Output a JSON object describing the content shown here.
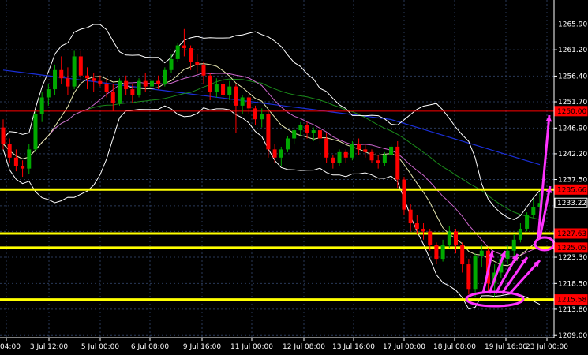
{
  "chart_data": {
    "type": "candlestick",
    "title": "",
    "xlabel": "",
    "ylabel": "",
    "ylim": [
      1209.0,
      1270.0
    ],
    "grid": true,
    "x_ticks": [
      "04:00",
      "3 Jul 12:00",
      "5 Jul 00:00",
      "6 Jul 08:00",
      "9 Jul 16:00",
      "11 Jul 00:00",
      "12 Jul 08:00",
      "13 Jul 16:00",
      "17 Jul 00:00",
      "18 Jul 08:00",
      "19 Jul 16:00",
      "23 Jul 00:00"
    ],
    "y_ticks": [
      1265.9,
      1261.2,
      1256.4,
      1251.7,
      1246.9,
      1242.2,
      1237.5,
      1232.7,
      1228.0,
      1223.3,
      1218.5,
      1213.8,
      1209.0
    ],
    "y_tick_labels": [
      "1265.90",
      "1261.20",
      "1256.40",
      "1251.70",
      "1246.90",
      "1242.20",
      "1237.50",
      "",
      "",
      "1223.30",
      "1218.50",
      "1213.80",
      "1209.00"
    ],
    "price_badges": [
      {
        "label": "1250.00",
        "value": 1250.0,
        "color": "#ff0000"
      },
      {
        "label": "1235.66",
        "value": 1235.66,
        "color": "#ff0000"
      },
      {
        "label": "1233.22",
        "value": 1233.22,
        "color": "#ffffff"
      },
      {
        "label": "1227.63",
        "value": 1227.63,
        "color": "#ff0000"
      },
      {
        "label": "1225.05",
        "value": 1225.05,
        "color": "#ff0000"
      },
      {
        "label": "1215.58",
        "value": 1215.58,
        "color": "#ff0000"
      }
    ],
    "horizontal_lines": [
      {
        "value": 1250.0,
        "color": "#ff0000"
      },
      {
        "value": 1235.66,
        "color": "#ffff00"
      },
      {
        "value": 1227.63,
        "color": "#ffff00"
      },
      {
        "value": 1225.05,
        "color": "#ffff00"
      },
      {
        "value": 1215.58,
        "color": "#ffff00"
      }
    ],
    "colors": {
      "up": "#00aa00",
      "down": "#ff0000",
      "grid": "#2a3a5a",
      "annotation": "#ff33ff",
      "blue_ma": "#1a2fd8",
      "green_ma": "#1a8a1a",
      "bands": "#ffffff",
      "mid_band": "#e8e8b0"
    },
    "candles": [
      [
        1247.0,
        1248.5,
        1243.0,
        1244.0
      ],
      [
        1244.0,
        1245.0,
        1240.5,
        1241.5
      ],
      [
        1241.5,
        1243.0,
        1239.0,
        1240.0
      ],
      [
        1240.0,
        1241.0,
        1238.0,
        1239.5
      ],
      [
        1239.5,
        1244.0,
        1238.5,
        1243.0
      ],
      [
        1243.0,
        1250.0,
        1242.5,
        1249.5
      ],
      [
        1249.5,
        1253.5,
        1248.0,
        1252.5
      ],
      [
        1252.5,
        1255.0,
        1251.0,
        1254.0
      ],
      [
        1254.0,
        1258.5,
        1253.0,
        1257.5
      ],
      [
        1257.5,
        1260.0,
        1255.0,
        1256.0
      ],
      [
        1256.0,
        1258.0,
        1253.0,
        1254.5
      ],
      [
        1254.5,
        1261.0,
        1254.0,
        1260.0
      ],
      [
        1260.0,
        1261.0,
        1255.5,
        1256.5
      ],
      [
        1256.5,
        1258.0,
        1254.0,
        1256.0
      ],
      [
        1256.0,
        1257.0,
        1253.5,
        1255.5
      ],
      [
        1255.5,
        1256.5,
        1254.5,
        1255.0
      ],
      [
        1255.0,
        1256.0,
        1252.5,
        1253.5
      ],
      [
        1253.5,
        1255.0,
        1250.0,
        1251.5
      ],
      [
        1251.5,
        1256.0,
        1251.0,
        1255.5
      ],
      [
        1255.5,
        1256.5,
        1253.0,
        1254.0
      ],
      [
        1254.0,
        1255.0,
        1251.5,
        1253.0
      ],
      [
        1253.0,
        1256.0,
        1252.5,
        1255.5
      ],
      [
        1255.5,
        1257.0,
        1253.5,
        1254.5
      ],
      [
        1254.5,
        1256.0,
        1253.5,
        1255.5
      ],
      [
        1255.5,
        1256.5,
        1254.0,
        1255.0
      ],
      [
        1255.0,
        1258.0,
        1254.5,
        1257.5
      ],
      [
        1257.5,
        1260.5,
        1257.0,
        1259.5
      ],
      [
        1259.5,
        1262.5,
        1259.0,
        1262.0
      ],
      [
        1262.0,
        1265.0,
        1260.0,
        1261.5
      ],
      [
        1261.5,
        1262.0,
        1257.5,
        1259.0
      ],
      [
        1259.0,
        1260.5,
        1257.0,
        1258.5
      ],
      [
        1258.5,
        1259.0,
        1255.0,
        1256.5
      ],
      [
        1256.5,
        1257.0,
        1252.0,
        1253.5
      ],
      [
        1253.5,
        1256.0,
        1252.5,
        1255.0
      ],
      [
        1255.0,
        1256.0,
        1251.5,
        1253.0
      ],
      [
        1253.0,
        1255.5,
        1252.0,
        1254.5
      ],
      [
        1254.5,
        1255.0,
        1246.0,
        1251.0
      ],
      [
        1251.0,
        1253.0,
        1249.5,
        1252.5
      ],
      [
        1252.5,
        1253.0,
        1249.5,
        1250.5
      ],
      [
        1250.5,
        1251.0,
        1247.5,
        1248.5
      ],
      [
        1248.5,
        1250.5,
        1247.0,
        1249.5
      ],
      [
        1249.5,
        1250.0,
        1241.5,
        1243.0
      ],
      [
        1243.0,
        1244.0,
        1240.5,
        1241.5
      ],
      [
        1241.5,
        1243.5,
        1240.0,
        1243.0
      ],
      [
        1243.0,
        1245.5,
        1242.5,
        1245.0
      ],
      [
        1245.0,
        1247.0,
        1244.0,
        1246.5
      ],
      [
        1246.5,
        1248.0,
        1245.5,
        1247.5
      ],
      [
        1247.5,
        1248.0,
        1245.0,
        1246.0
      ],
      [
        1246.0,
        1247.0,
        1244.5,
        1246.5
      ],
      [
        1246.5,
        1247.5,
        1244.0,
        1245.0
      ],
      [
        1245.0,
        1246.0,
        1240.5,
        1241.5
      ],
      [
        1241.5,
        1242.0,
        1239.5,
        1240.5
      ],
      [
        1240.5,
        1243.0,
        1240.0,
        1242.5
      ],
      [
        1242.5,
        1243.0,
        1240.5,
        1241.5
      ],
      [
        1241.5,
        1244.5,
        1241.0,
        1244.0
      ],
      [
        1244.0,
        1245.0,
        1242.0,
        1243.0
      ],
      [
        1243.0,
        1244.0,
        1241.5,
        1242.5
      ],
      [
        1242.5,
        1243.0,
        1240.5,
        1241.0
      ],
      [
        1241.0,
        1242.0,
        1239.5,
        1240.5
      ],
      [
        1240.5,
        1242.5,
        1240.0,
        1242.0
      ],
      [
        1242.0,
        1244.0,
        1241.5,
        1243.5
      ],
      [
        1243.5,
        1244.5,
        1236.0,
        1237.5
      ],
      [
        1237.5,
        1238.0,
        1231.0,
        1232.0
      ],
      [
        1232.0,
        1233.0,
        1228.0,
        1229.5
      ],
      [
        1229.5,
        1231.0,
        1227.5,
        1228.5
      ],
      [
        1228.5,
        1229.5,
        1226.5,
        1228.0
      ],
      [
        1228.0,
        1228.5,
        1224.5,
        1225.5
      ],
      [
        1225.5,
        1226.0,
        1222.0,
        1223.0
      ],
      [
        1223.0,
        1226.5,
        1222.5,
        1225.5
      ],
      [
        1225.5,
        1229.0,
        1225.0,
        1228.0
      ],
      [
        1228.0,
        1228.5,
        1224.0,
        1225.5
      ],
      [
        1225.5,
        1226.0,
        1220.5,
        1222.0
      ],
      [
        1222.0,
        1223.0,
        1216.5,
        1217.5
      ],
      [
        1217.5,
        1224.0,
        1216.0,
        1223.5
      ],
      [
        1223.5,
        1225.5,
        1221.5,
        1224.5
      ],
      [
        1224.5,
        1225.0,
        1217.0,
        1218.5
      ],
      [
        1218.5,
        1222.0,
        1216.0,
        1220.5
      ],
      [
        1220.5,
        1224.0,
        1219.5,
        1223.0
      ],
      [
        1223.0,
        1225.5,
        1222.0,
        1224.5
      ],
      [
        1224.5,
        1227.5,
        1223.5,
        1226.5
      ],
      [
        1226.5,
        1229.5,
        1226.0,
        1228.5
      ],
      [
        1228.5,
        1231.5,
        1228.0,
        1231.0
      ],
      [
        1231.0,
        1234.0,
        1230.5,
        1232.5
      ],
      [
        1232.5,
        1235.0,
        1231.5,
        1233.22
      ]
    ]
  }
}
